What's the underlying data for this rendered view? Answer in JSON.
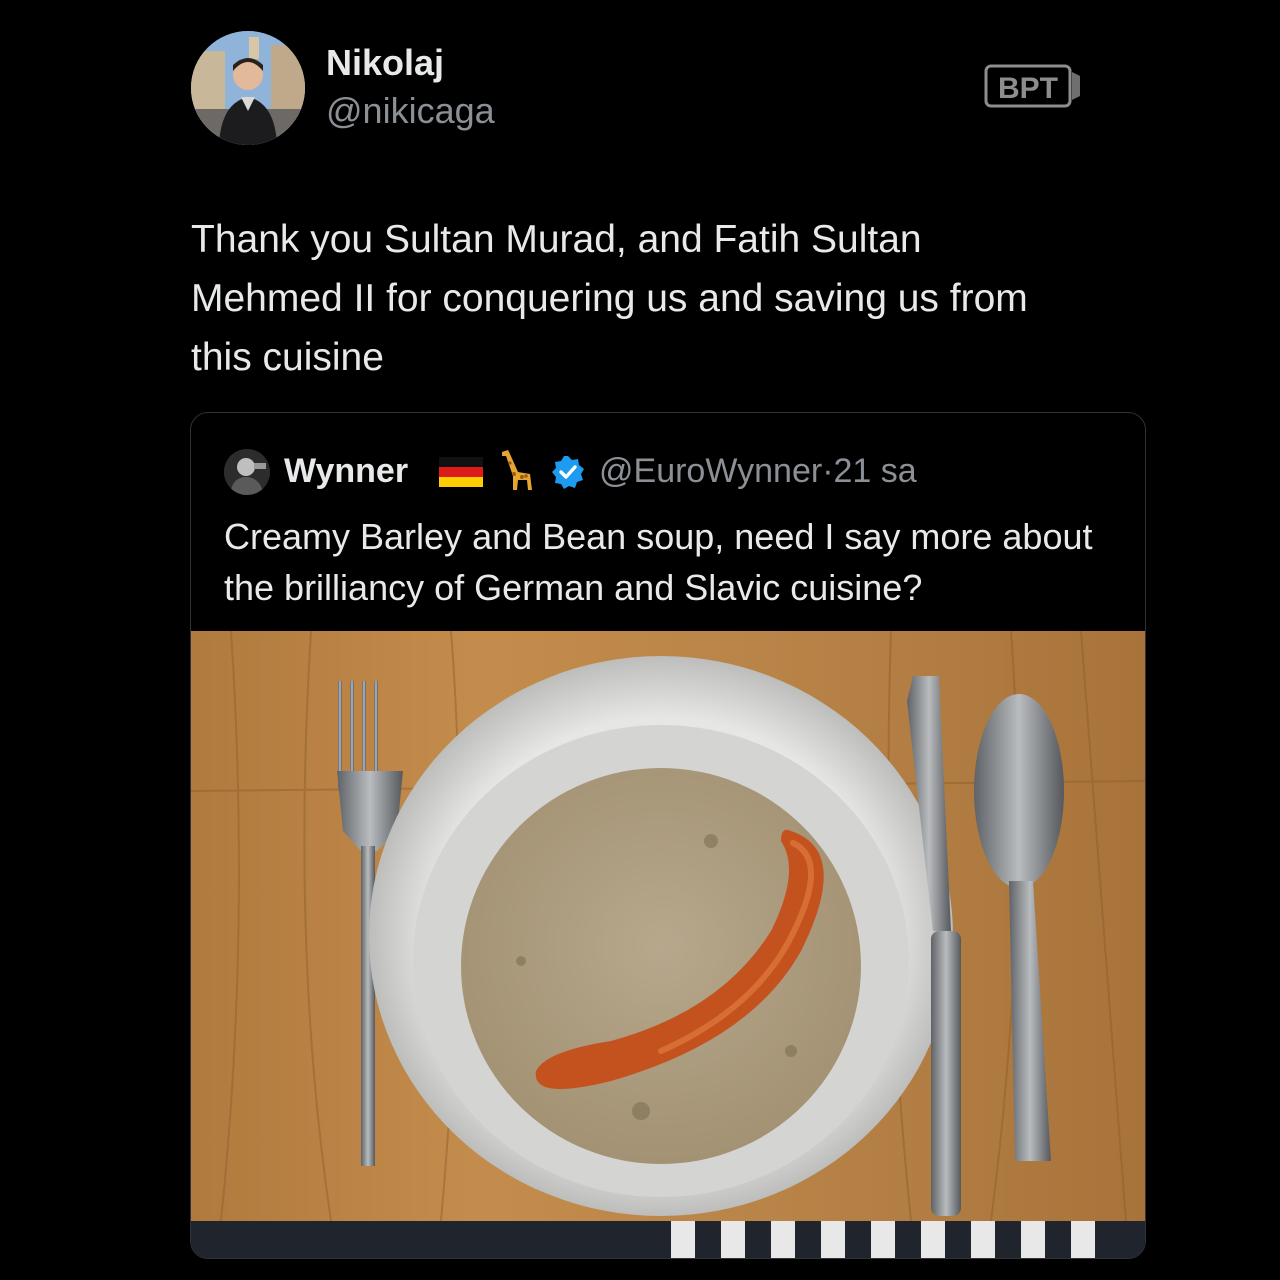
{
  "tweet": {
    "author_name": "Nikolaj",
    "author_handle": "@nikicaga",
    "text": "Thank you Sultan Murad, and Fatih Sultan\nMehmed II for conquering us and saving us from\nthis cuisine"
  },
  "watermark": {
    "text": "BPT"
  },
  "quote": {
    "author_name": "Wynner",
    "flag_icon": "germany-flag-icon",
    "emoji_icon": "giraffe-icon",
    "verified_icon": "verified-badge-icon",
    "author_handle": "@EuroWynner",
    "separator": "·",
    "time": "21 sa",
    "text": "Creamy Barley and Bean soup, need I say more about the brilliancy of German and Slavic cuisine?"
  },
  "colors": {
    "background": "#000000",
    "text": "#e7e9ea",
    "muted": "#8b9096",
    "verified": "#1d9bf0"
  }
}
